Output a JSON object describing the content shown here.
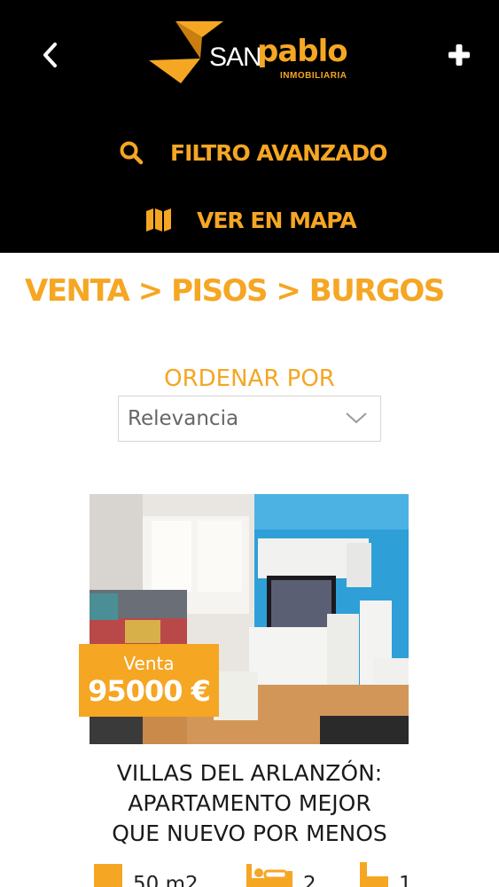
{
  "header": {
    "brand": {
      "san": "SAN",
      "pablo": "pablo",
      "sub": "INMOBILIARIA"
    },
    "filter_label": "FILTRO AVANZADO",
    "map_label": "VER EN MAPA",
    "accent_color": "#f5a623",
    "icons": {
      "back": "chevron-left-icon",
      "add": "plus-icon",
      "search": "search-icon",
      "map": "map-icon"
    }
  },
  "breadcrumb": {
    "items": [
      "VENTA",
      "PISOS",
      "BURGOS"
    ],
    "separator": ">"
  },
  "sort": {
    "label": "ORDENAR POR",
    "selected": "Relevancia"
  },
  "listing": {
    "type": "Venta",
    "price": "95000 €",
    "title_lines": [
      "VILLAS DEL ARLANZÓN:",
      "APARTAMENTO MEJOR",
      "QUE NUEVO POR MENOS"
    ],
    "features": {
      "area": "50 m2",
      "bedrooms": "2",
      "bathrooms": "1"
    }
  }
}
